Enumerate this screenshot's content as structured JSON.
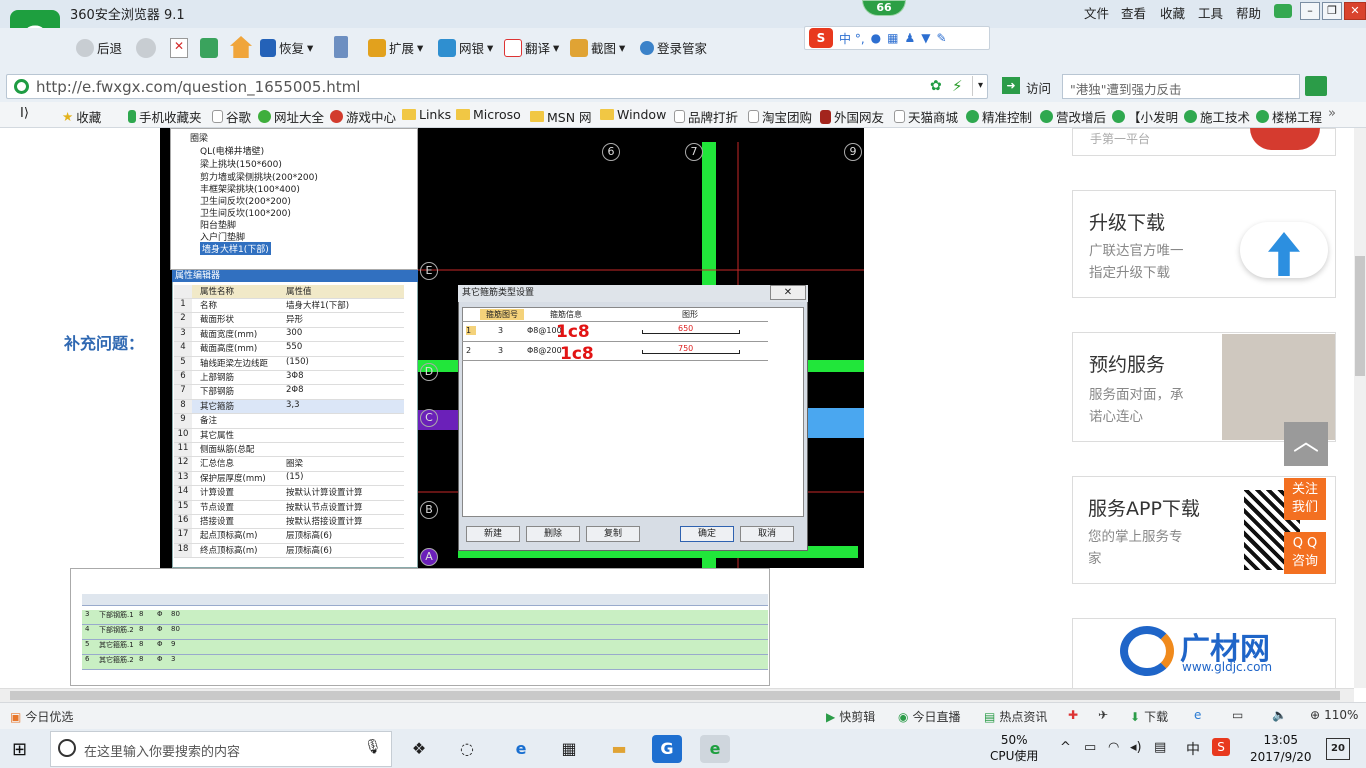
{
  "window": {
    "title": "360安全浏览器 9.1",
    "badge": "66",
    "menu": [
      "文件",
      "查看",
      "收藏",
      "工具",
      "帮助"
    ]
  },
  "toolbar": {
    "back": "后退",
    "restore": "恢复",
    "extend": "扩展",
    "bank": "网银",
    "translate": "翻译",
    "screenshot": "截图",
    "login": "登录管家",
    "ime_label": "中 °,"
  },
  "address": {
    "url": "http://e.fwxgx.com/question_1655005.html",
    "visit": "访问",
    "search_placeholder": "\"港独\"遭到强力反击"
  },
  "bookmarks": [
    "收藏",
    "手机收藏夹",
    "谷歌",
    "网址大全",
    "游戏中心",
    "Links",
    "Microso",
    "MSN 网",
    "Window",
    "品牌打折",
    "淘宝团购",
    "外国网友",
    "天猫商城",
    "精准控制",
    "营改增后",
    "【小发明",
    "施工技术",
    "楼梯工程"
  ],
  "page": {
    "supplement_label": "补充问题：",
    "cards": [
      {
        "title": "",
        "sub": "",
        "partial": "手第一平台"
      },
      {
        "title": "升级下载",
        "sub": "广联达官方唯一\n指定升级下载"
      },
      {
        "title": "预约服务",
        "sub": "服务面对面，承\n诺心连心"
      },
      {
        "title": "服务APP下载",
        "sub": "您的掌上服务专\n家"
      },
      {
        "title": "广材网",
        "sub": "www.gldjc.com"
      }
    ],
    "follow_us": "关注\n我们",
    "qq": "Q Q\n咨询"
  },
  "cad": {
    "tree_items": [
      "圈梁",
      "QL(电梯井墙壁)",
      "梁上挑块(150*600)",
      "剪力墙或梁侧挑块(200*200)",
      "丰框架梁挑块(100*400)",
      "卫生间反坎(200*200)",
      "卫生间反坎(100*200)",
      "阳台垫脚",
      "入户门垫脚",
      "墙身大样1(下部)"
    ],
    "prop_title": "属性编辑器",
    "prop_headers": [
      "属性名称",
      "属性值"
    ],
    "props": [
      [
        "1",
        "名称",
        "墙身大样1(下部)"
      ],
      [
        "2",
        "截面形状",
        "异形"
      ],
      [
        "3",
        "截面宽度(mm)",
        "300"
      ],
      [
        "4",
        "截面高度(mm)",
        "550"
      ],
      [
        "5",
        "轴线距梁左边线距",
        "(150)"
      ],
      [
        "6",
        "上部钢筋",
        "3Φ8"
      ],
      [
        "7",
        "下部钢筋",
        "2Φ8"
      ],
      [
        "8",
        "其它箍筋",
        "3,3"
      ],
      [
        "9",
        "备注",
        ""
      ],
      [
        "10",
        "其它属性",
        ""
      ],
      [
        "11",
        "侧面纵筋(总配",
        ""
      ],
      [
        "12",
        "汇总信息",
        "圈梁"
      ],
      [
        "13",
        "保护层厚度(mm)",
        "(15)"
      ],
      [
        "14",
        "计算设置",
        "按默认计算设置计算"
      ],
      [
        "15",
        "节点设置",
        "按默认节点设置计算"
      ],
      [
        "16",
        "搭接设置",
        "按默认搭接设置计算"
      ],
      [
        "17",
        "起点顶标高(m)",
        "层顶标高(6)"
      ],
      [
        "18",
        "终点顶标高(m)",
        "层顶标高(6)"
      ]
    ],
    "axes_top": [
      "6",
      "7",
      "9"
    ],
    "axes_left": [
      "E",
      "D",
      "C",
      "B",
      "A"
    ],
    "dialog": {
      "title": "其它箍筋类型设置",
      "headers": [
        "箍筋图号",
        "箍筋信息",
        "图形"
      ],
      "rows": [
        {
          "idx": "1",
          "no": "3",
          "info": "Φ8@100",
          "ann": "1c8",
          "dim": "650"
        },
        {
          "idx": "2",
          "no": "3",
          "info": "Φ8@200",
          "ann": "1c8",
          "dim": "750"
        }
      ],
      "buttons": [
        "新建",
        "删除",
        "复制",
        "确定",
        "取消"
      ]
    },
    "bottom_rows": [
      [
        "3",
        "下部钢筋.1",
        "8",
        "Φ",
        "80"
      ],
      [
        "4",
        "下部钢筋.2",
        "8",
        "Φ",
        "80"
      ],
      [
        "5",
        "其它箍筋.1",
        "8",
        "Φ",
        "9"
      ],
      [
        "6",
        "其它箍筋.2",
        "8",
        "Φ",
        "3"
      ]
    ]
  },
  "status": {
    "items": [
      "今日优选",
      "快剪辑",
      "今日直播",
      "热点资讯",
      "下载",
      "110%"
    ]
  },
  "taskbar": {
    "search": "在这里输入你要搜索的内容",
    "cpu_pct": "50%",
    "cpu_label": "CPU使用",
    "ime": "中",
    "time": "13:05",
    "date": "2017/9/20",
    "notif": "20"
  }
}
